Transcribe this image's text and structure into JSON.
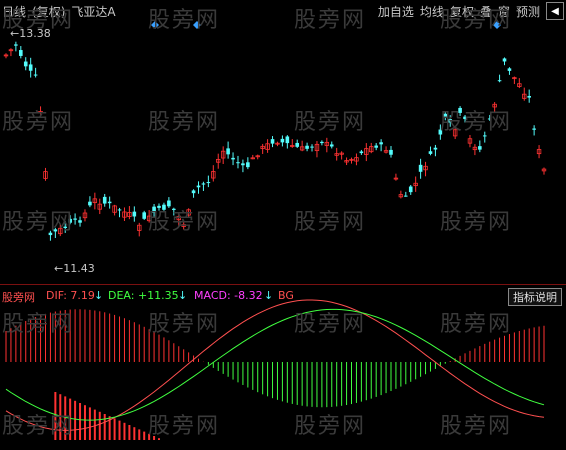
{
  "header": {
    "period": "日线",
    "adjust": "(复权)",
    "stock_name": "飞亚达A",
    "menu": [
      "加自选",
      "均线",
      "复权",
      "叠",
      "窗",
      "预测"
    ]
  },
  "price_chart": {
    "high_label": "13.38",
    "low_label": "11.43",
    "up_color": "#ff3232",
    "down_color": "#54fcfc"
  },
  "indicator": {
    "name": "股旁网",
    "dif_label": "DIF: 7.19",
    "dea_label": "DEA: +11.35",
    "macd_label": "MACD: -8.32",
    "bg_label": "BG",
    "help_label": "指标说明"
  },
  "watermark_text": "股旁网",
  "chart_data": {
    "type": "candlestick",
    "series_count": 110,
    "highest": 13.38,
    "lowest": 11.43,
    "macd": {
      "dif": 7.19,
      "dea": 11.35,
      "macd": -8.32
    }
  }
}
